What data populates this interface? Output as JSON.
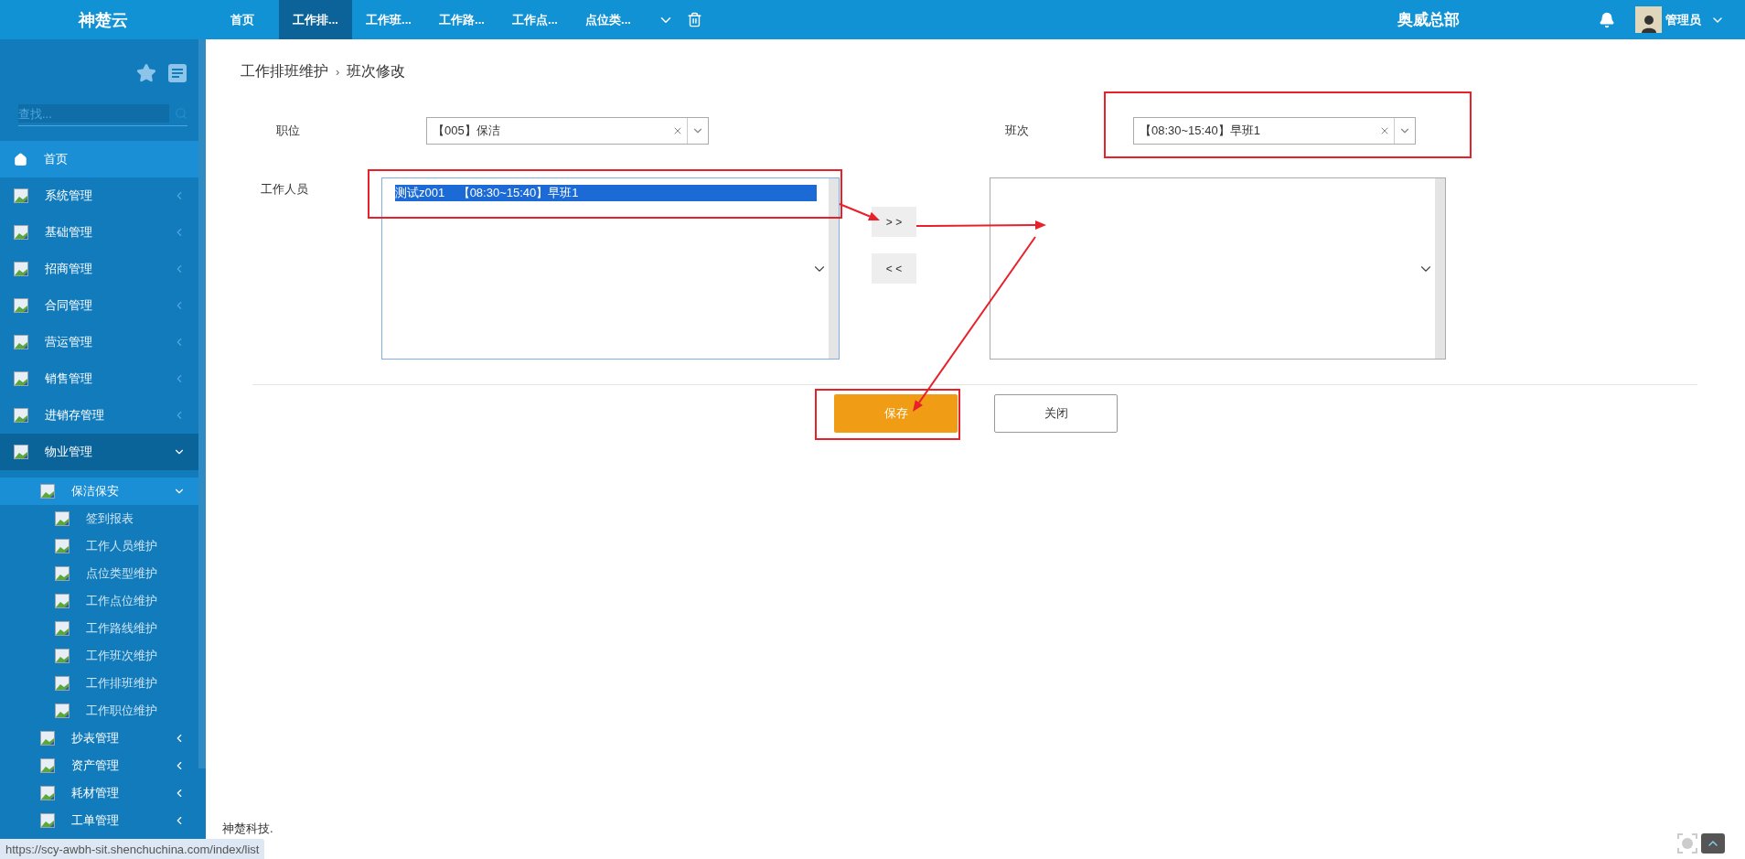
{
  "app": {
    "logo": "神楚云"
  },
  "tabs": [
    {
      "label": "首页",
      "selected": false
    },
    {
      "label": "工作排...",
      "selected": true
    },
    {
      "label": "工作班...",
      "selected": false
    },
    {
      "label": "工作路...",
      "selected": false
    },
    {
      "label": "工作点...",
      "selected": false
    },
    {
      "label": "点位类...",
      "selected": false
    }
  ],
  "header": {
    "org": "奥威总部",
    "user": "管理员"
  },
  "sidebar": {
    "search": {
      "placeholder": "查找..."
    },
    "items": [
      {
        "label": "首页",
        "kind": "home",
        "selected": true
      },
      {
        "label": "系统管理",
        "kind": "group",
        "selected": false,
        "expanded": false
      },
      {
        "label": "基础管理",
        "kind": "group",
        "selected": false,
        "expanded": false
      },
      {
        "label": "招商管理",
        "kind": "group",
        "selected": false,
        "expanded": false
      },
      {
        "label": "合同管理",
        "kind": "group",
        "selected": false,
        "expanded": false
      },
      {
        "label": "营运管理",
        "kind": "group",
        "selected": false,
        "expanded": false
      },
      {
        "label": "销售管理",
        "kind": "group",
        "selected": false,
        "expanded": false
      },
      {
        "label": "进销存管理",
        "kind": "group",
        "selected": false,
        "expanded": false
      },
      {
        "label": "物业管理",
        "kind": "group",
        "selected": false,
        "expanded": true,
        "children": [
          {
            "label": "保洁保安",
            "kind": "group",
            "selected": true,
            "expanded": true,
            "children": [
              {
                "label": "签到报表",
                "kind": "page",
                "selected": false
              },
              {
                "label": "工作人员维护",
                "kind": "page",
                "selected": false
              },
              {
                "label": "点位类型维护",
                "kind": "page",
                "selected": false
              },
              {
                "label": "工作点位维护",
                "kind": "page",
                "selected": false
              },
              {
                "label": "工作路线维护",
                "kind": "page",
                "selected": false
              },
              {
                "label": "工作班次维护",
                "kind": "page",
                "selected": false
              },
              {
                "label": "工作排班维护",
                "kind": "page",
                "selected": false
              },
              {
                "label": "工作职位维护",
                "kind": "page",
                "selected": false
              }
            ]
          },
          {
            "label": "抄表管理",
            "kind": "group",
            "selected": false,
            "expanded": false
          },
          {
            "label": "资产管理",
            "kind": "group",
            "selected": false,
            "expanded": false
          },
          {
            "label": "耗材管理",
            "kind": "group",
            "selected": false,
            "expanded": false
          },
          {
            "label": "工单管理",
            "kind": "group",
            "selected": false,
            "expanded": false
          }
        ]
      }
    ]
  },
  "breadcrumb": [
    "工作排班维护",
    "›",
    "班次修改"
  ],
  "form": {
    "position": {
      "label": "职位",
      "value": "【005】保洁"
    },
    "shift": {
      "label": "班次",
      "value": "【08:30~15:40】早班1"
    },
    "staff": {
      "label": "工作人员",
      "available": [
        {
          "text": "测试z001    【08:30~15:40】早班1",
          "selected": true
        }
      ]
    },
    "move_buttons": [
      "> >",
      "< <"
    ],
    "actions": [
      {
        "label": "保存",
        "kind": "primary"
      },
      {
        "label": "关闭",
        "kind": "default"
      }
    ]
  },
  "footer": {
    "company": "神楚科技."
  },
  "status_url": "https://scy-awbh-sit.shenchuchina.com/index/list"
}
